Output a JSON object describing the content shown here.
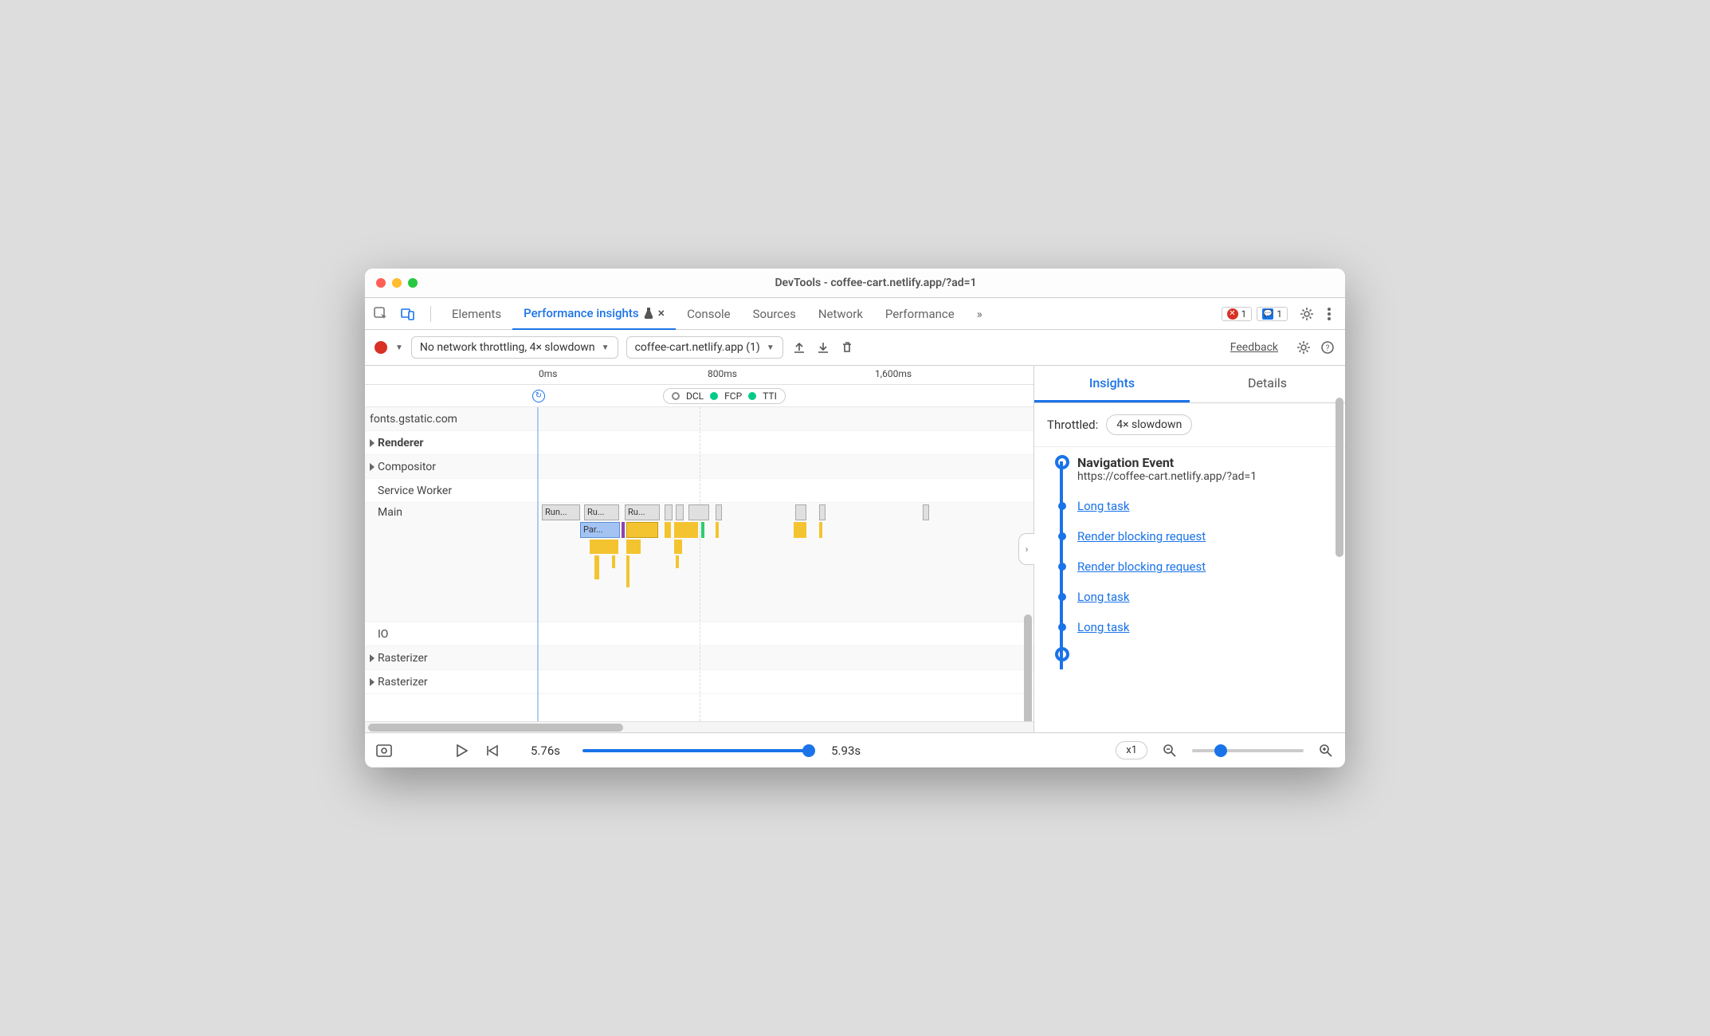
{
  "window_title": "DevTools - coffee-cart.netlify.app/?ad=1",
  "tabs": {
    "elements": "Elements",
    "perf_insights": "Performance insights",
    "console": "Console",
    "sources": "Sources",
    "network": "Network",
    "performance": "Performance",
    "more": "»"
  },
  "badges": {
    "errors": "1",
    "messages": "1"
  },
  "toolbar": {
    "throttle_select": "No network throttling, 4× slowdown",
    "target_select": "coffee-cart.netlify.app (1)",
    "feedback": "Feedback"
  },
  "time_ticks": {
    "t0": "0ms",
    "t800": "800ms",
    "t1600": "1,600ms"
  },
  "markers": {
    "dcl": "DCL",
    "fcp": "FCP",
    "tti": "TTI"
  },
  "tracks": {
    "fonts": "fonts.gstatic.com",
    "renderer": "Renderer",
    "compositor": "Compositor",
    "service_worker": "Service Worker",
    "main": "Main",
    "io": "IO",
    "rasterizer": "Rasterizer"
  },
  "flame": {
    "run": "Run...",
    "ru": "Ru...",
    "par": "Par..."
  },
  "insights": {
    "tab_insights": "Insights",
    "tab_details": "Details",
    "throttled_label": "Throttled:",
    "throttled_value": "4× slowdown",
    "nav_title": "Navigation Event",
    "nav_url": "https://coffee-cart.netlify.app/?ad=1",
    "items": [
      "Long task",
      "Render blocking request",
      "Render blocking request",
      "Long task",
      "Long task"
    ]
  },
  "bottom": {
    "time_start": "5.76s",
    "time_end": "5.93s",
    "zoom": "x1"
  }
}
